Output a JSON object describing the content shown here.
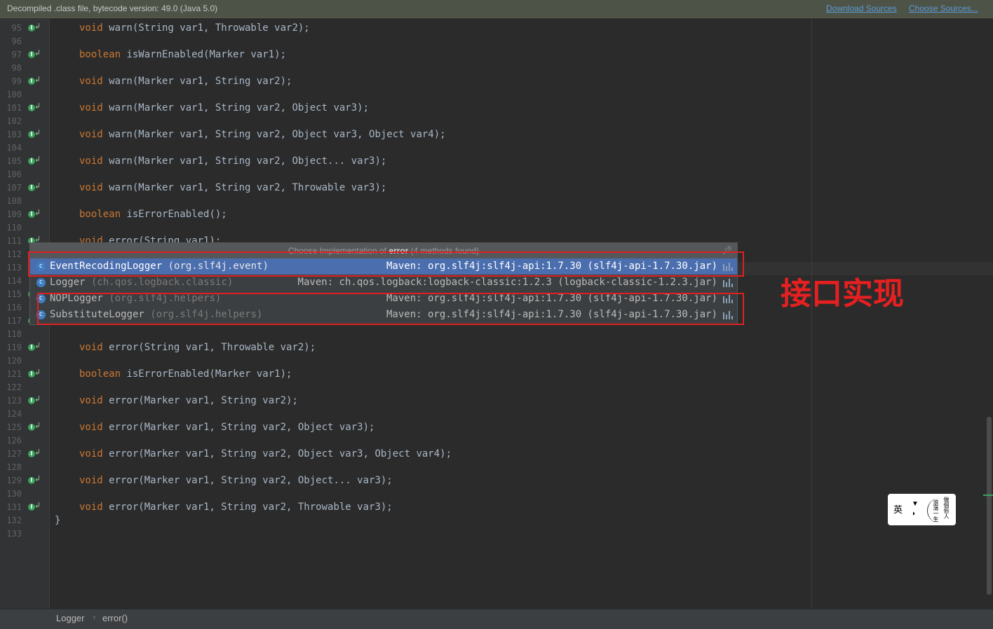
{
  "banner": {
    "message": "Decompiled .class file, bytecode version: 49.0 (Java 5.0)",
    "download_sources": "Download Sources",
    "choose_sources": "Choose Sources..."
  },
  "code_lines": [
    {
      "num": "95",
      "icon": true,
      "kw": "void",
      "rest": " warn(String var1, Throwable var2);"
    },
    {
      "num": "97",
      "icon": true,
      "kw": "boolean",
      "rest": " isWarnEnabled(Marker var1);"
    },
    {
      "num": "99",
      "icon": true,
      "kw": "void",
      "rest": " warn(Marker var1, String var2);"
    },
    {
      "num": "101",
      "icon": true,
      "kw": "void",
      "rest": " warn(Marker var1, String var2, Object var3);"
    },
    {
      "num": "103",
      "icon": true,
      "kw": "void",
      "rest": " warn(Marker var1, String var2, Object var3, Object var4);"
    },
    {
      "num": "105",
      "icon": true,
      "kw": "void",
      "rest": " warn(Marker var1, String var2, Object... var3);"
    },
    {
      "num": "107",
      "icon": true,
      "kw": "void",
      "rest": " warn(Marker var1, String var2, Throwable var3);"
    },
    {
      "num": "109",
      "icon": true,
      "kw": "boolean",
      "rest": " isErrorEnabled();"
    },
    {
      "num": "111",
      "icon": true,
      "kw": "void",
      "rest": " error(String var1);"
    },
    {
      "num": "113",
      "icon": true,
      "kw": "",
      "rest": ""
    },
    {
      "num": "115",
      "icon": true,
      "kw": "",
      "rest": ""
    },
    {
      "num": "117",
      "icon": true,
      "kw": "",
      "rest": ""
    },
    {
      "num": "119",
      "icon": true,
      "kw": "void",
      "rest": " error(String var1, Throwable var2);"
    },
    {
      "num": "121",
      "icon": true,
      "kw": "boolean",
      "rest": " isErrorEnabled(Marker var1);"
    },
    {
      "num": "123",
      "icon": true,
      "kw": "void",
      "rest": " error(Marker var1, String var2);"
    },
    {
      "num": "125",
      "icon": true,
      "kw": "void",
      "rest": " error(Marker var1, String var2, Object var3);"
    },
    {
      "num": "127",
      "icon": true,
      "kw": "void",
      "rest": " error(Marker var1, String var2, Object var3, Object var4);"
    },
    {
      "num": "129",
      "icon": true,
      "kw": "void",
      "rest": " error(Marker var1, String var2, Object... var3);"
    },
    {
      "num": "131",
      "icon": true,
      "kw": "void",
      "rest": " error(Marker var1, String var2, Throwable var3);"
    }
  ],
  "blank_line_numbers": [
    "96",
    "98",
    "100",
    "102",
    "104",
    "106",
    "108",
    "110",
    "112",
    "114",
    "116",
    "118",
    "120",
    "122",
    "124",
    "126",
    "128",
    "130",
    "132",
    "133"
  ],
  "closing_brace": "}",
  "popup": {
    "title_prefix": "Choose Implementation of ",
    "title_method": "error",
    "title_suffix": " (4 methods found)",
    "items": [
      {
        "class": "EventRecodingLogger",
        "package": " (org.slf4j.event)",
        "location": "Maven: org.slf4j:slf4j-api:1.7.30 (slf4j-api-1.7.30.jar)",
        "selected": true
      },
      {
        "class": "Logger",
        "package": " (ch.qos.logback.classic)",
        "location": "Maven: ch.qos.logback:logback-classic:1.2.3 (logback-classic-1.2.3.jar)",
        "selected": false
      },
      {
        "class": "NOPLogger",
        "package": " (org.slf4j.helpers)",
        "location": "Maven: org.slf4j:slf4j-api:1.7.30 (slf4j-api-1.7.30.jar)",
        "selected": false
      },
      {
        "class": "SubstituteLogger",
        "package": " (org.slf4j.helpers)",
        "location": "Maven: org.slf4j:slf4j-api:1.7.30 (slf4j-api-1.7.30.jar)",
        "selected": false
      }
    ]
  },
  "annotation": "接口实现",
  "watermark": {
    "left_char": "英",
    "right_col1": "做個俗人",
    "right_col2": "浪蕩一生"
  },
  "status_bar": {
    "breadcrumbs": [
      "Logger",
      "error()"
    ],
    "separator": "›"
  },
  "colors": {
    "keyword": "#cc7832",
    "code_text": "#a9b7c6",
    "selection": "#4b6eaf",
    "annotation_red": "#e62020"
  }
}
